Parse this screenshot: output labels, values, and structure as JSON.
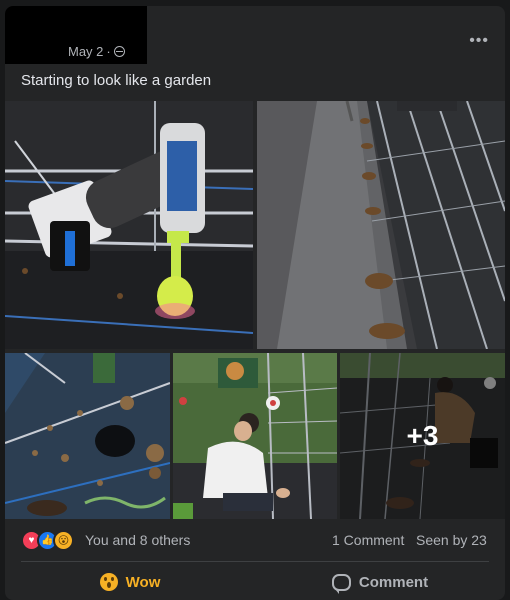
{
  "post": {
    "date": "May 2",
    "date_separator": "·",
    "caption": "Starting to look like a garden",
    "more_label": "•••"
  },
  "photos": {
    "extra_count": "+3"
  },
  "stats": {
    "reactions_text": "You and 8 others",
    "comments_text": "1 Comment",
    "seen_text": "Seen by 23"
  },
  "actions": {
    "react_label": "Wow",
    "comment_label": "Comment"
  },
  "colors": {
    "background": "#18191a",
    "card": "#242526",
    "wow": "#f7b125",
    "like": "#1877f2",
    "love": "#f33e58"
  },
  "icons": [
    "globe-icon",
    "more-icon",
    "love-reaction-icon",
    "like-reaction-icon",
    "wow-reaction-icon",
    "wow-action-icon",
    "comment-icon"
  ]
}
